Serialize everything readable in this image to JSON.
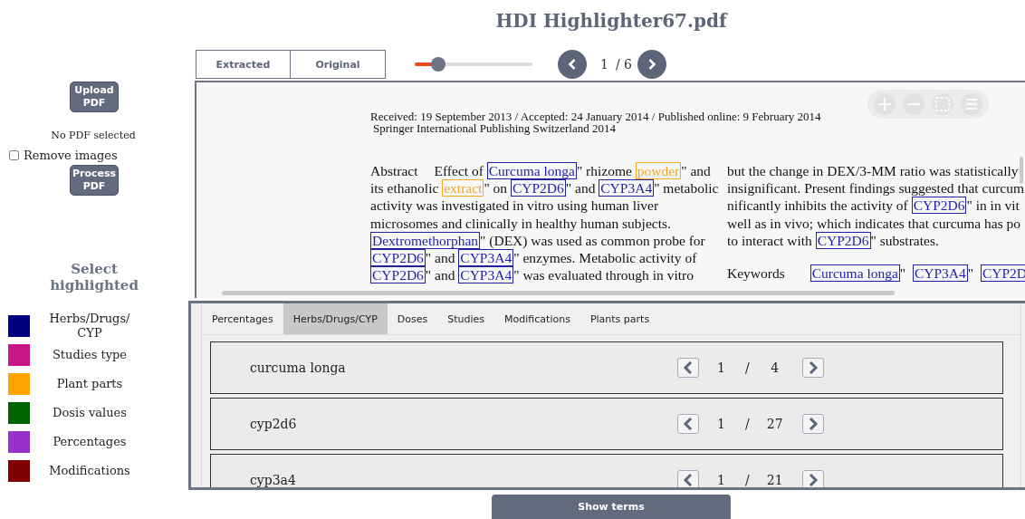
{
  "title": "HDI Highlighter67.pdf",
  "sidebar": {
    "upload_button": "Upload PDF",
    "file_status": "No PDF selected",
    "remove_images": {
      "label": "Remove images",
      "checked": false
    },
    "process_button": "Process PDF",
    "legend": {
      "title": "Select highlighted",
      "items": [
        {
          "label": "Herbs/Drugs/CYP",
          "color": "#000080"
        },
        {
          "label": "Studies type",
          "color": "#c71585"
        },
        {
          "label": "Plant parts",
          "color": "#ffa500"
        },
        {
          "label": "Dosis values",
          "color": "#006400"
        },
        {
          "label": "Percentages",
          "color": "#9932cc"
        },
        {
          "label": "Modifications",
          "color": "#800000"
        }
      ]
    }
  },
  "view_tabs": [
    {
      "label": "Extracted"
    },
    {
      "label": "Original"
    }
  ],
  "zoom_slider": {
    "level": 0.2
  },
  "pager": {
    "current": "1",
    "total": "/ 6"
  },
  "document": {
    "header_lines": [
      "Received: 19 September 2013 / Accepted: 24 January 2014 / Published online: 9 February 2014",
      "Springer International Publishing Switzerland 2014"
    ],
    "columns": [
      [
        [
          [
            {
              "kind": "heading",
              "text": "Abstract"
            },
            {
              "kind": "text",
              "text": "Effect of "
            },
            {
              "kind": "term",
              "text": "Curcuma longa"
            },
            {
              "kind": "text",
              "text": "\" rhizome "
            },
            {
              "kind": "part",
              "text": "powder"
            },
            {
              "kind": "text",
              "text": "\" and"
            }
          ],
          [
            {
              "kind": "text",
              "text": "its ethanolic "
            },
            {
              "kind": "part",
              "text": "extract"
            },
            {
              "kind": "text",
              "text": "\" on "
            },
            {
              "kind": "term",
              "text": "CYP2D6"
            },
            {
              "kind": "text",
              "text": "\" and "
            },
            {
              "kind": "term",
              "text": "CYP3A4"
            },
            {
              "kind": "text",
              "text": "\" metabolic"
            }
          ],
          [
            {
              "kind": "text",
              "text": "activity was investigated in vitro using human liver"
            }
          ],
          [
            {
              "kind": "text",
              "text": "microsomes and clinically in healthy human subjects."
            }
          ],
          [
            {
              "kind": "term",
              "text": "Dextromethorphan"
            },
            {
              "kind": "text",
              "text": "\" (DEX) was used as common probe for"
            }
          ],
          [
            {
              "kind": "term",
              "text": "CYP2D6"
            },
            {
              "kind": "text",
              "text": "\" and "
            },
            {
              "kind": "term",
              "text": "CYP3A4"
            },
            {
              "kind": "text",
              "text": "\" enzymes. Metabolic activity of"
            }
          ],
          [
            {
              "kind": "term",
              "text": "CYP2D6"
            },
            {
              "kind": "text",
              "text": "\" and "
            },
            {
              "kind": "term",
              "text": "CYP3A4"
            },
            {
              "kind": "text",
              "text": "\" was evaluated through in vitro"
            }
          ]
        ]
      ],
      [
        [
          [
            {
              "kind": "text",
              "text": "but the change in DEX/3-MM ratio was statistically"
            }
          ],
          [
            {
              "kind": "text",
              "text": "insignificant. Present findings suggested that curcum"
            }
          ],
          [
            {
              "kind": "text",
              "text": "nificantly inhibits the activity of "
            },
            {
              "kind": "term",
              "text": "CYP2D6"
            },
            {
              "kind": "text",
              "text": "\" in in vit"
            }
          ],
          [
            {
              "kind": "text",
              "text": "well as in vivo; which indicates that curcuma has po"
            }
          ],
          [
            {
              "kind": "text",
              "text": "to interact with "
            },
            {
              "kind": "term",
              "text": "CYP2D6"
            },
            {
              "kind": "text",
              "text": "\" substrates."
            }
          ]
        ],
        [
          [
            {
              "kind": "heading",
              "text": "Keywords"
            },
            {
              "kind": "term",
              "text": "Curcuma longa"
            },
            {
              "kind": "text",
              "text": "\"  "
            },
            {
              "kind": "term",
              "text": "CYP3A4"
            },
            {
              "kind": "text",
              "text": "\"  "
            },
            {
              "kind": "term",
              "text": "CYP2D"
            }
          ]
        ]
      ]
    ]
  },
  "terms_panel": {
    "tabs": [
      {
        "label": "Percentages",
        "selected": false
      },
      {
        "label": "Herbs/Drugs/CYP",
        "selected": true
      },
      {
        "label": "Doses",
        "selected": false
      },
      {
        "label": "Studies",
        "selected": false
      },
      {
        "label": "Modifications",
        "selected": false
      },
      {
        "label": "Plants parts",
        "selected": false
      }
    ],
    "terms": [
      {
        "name": "curcuma longa",
        "current": "1",
        "separator": "/",
        "total": "4"
      },
      {
        "name": "cyp2d6",
        "current": "1",
        "separator": "/",
        "total": "27"
      },
      {
        "name": "cyp3a4",
        "current": "1",
        "separator": "/",
        "total": "21"
      }
    ]
  },
  "show_terms_button": "Show terms"
}
